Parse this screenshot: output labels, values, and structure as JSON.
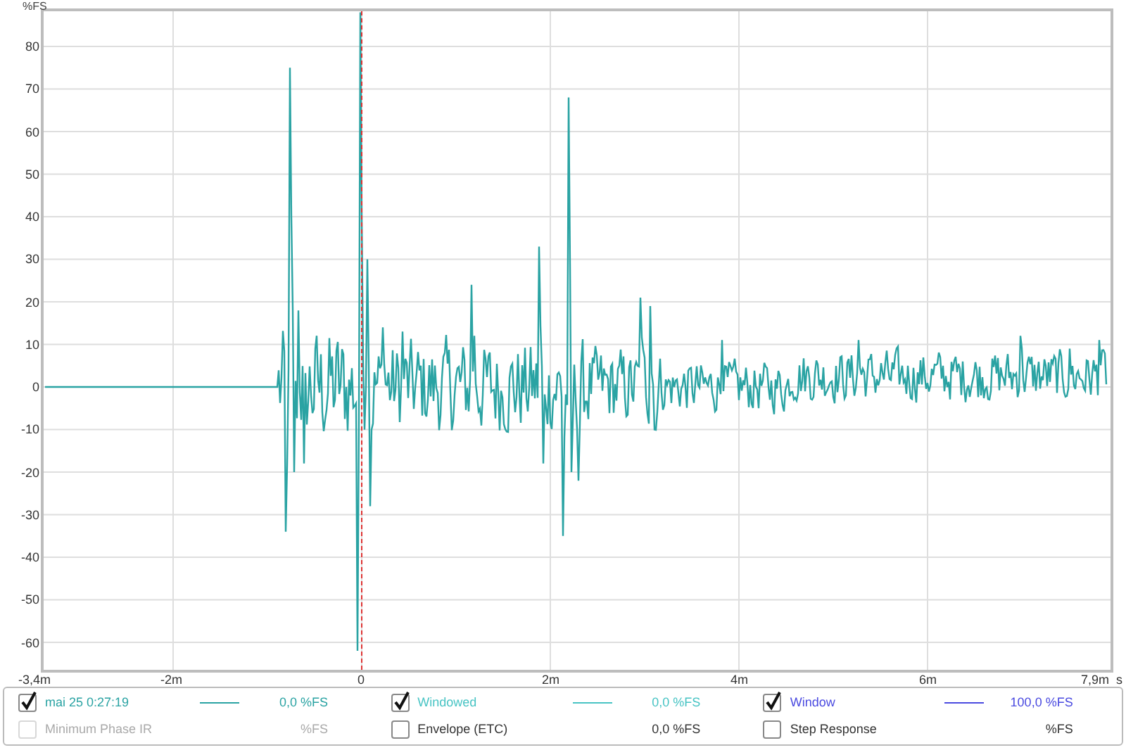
{
  "chart": {
    "y_unit": "%FS",
    "x_unit": "s",
    "y_ticks": [
      "80",
      "70",
      "60",
      "50",
      "40",
      "30",
      "20",
      "10",
      "0",
      "-10",
      "-20",
      "-30",
      "-40",
      "-50",
      "-60"
    ],
    "x_ticks": [
      "-3,4m",
      "-2m",
      "0",
      "2m",
      "4m",
      "6m",
      "7,9m"
    ]
  },
  "legend": {
    "items": [
      {
        "kind": "trace",
        "label": "mai 25 0:27:19",
        "checked": true,
        "disabled": false,
        "color": "#2aa3a3",
        "reading": "0,0 %FS"
      },
      {
        "kind": "trace",
        "label": "Windowed",
        "checked": true,
        "disabled": false,
        "color": "#48c4c4",
        "reading": "0,0 %FS"
      },
      {
        "kind": "trace",
        "label": "Window",
        "checked": true,
        "disabled": false,
        "color": "#4a4ae0",
        "reading": "100,0 %FS"
      },
      {
        "kind": "plain",
        "label": "Minimum Phase IR",
        "checked": false,
        "disabled": true,
        "reading": "%FS"
      },
      {
        "kind": "plain",
        "label": "Envelope (ETC)",
        "checked": false,
        "disabled": false,
        "reading": "0,0 %FS"
      },
      {
        "kind": "plain",
        "label": "Step Response",
        "checked": false,
        "disabled": false,
        "reading": "%FS"
      }
    ]
  }
}
